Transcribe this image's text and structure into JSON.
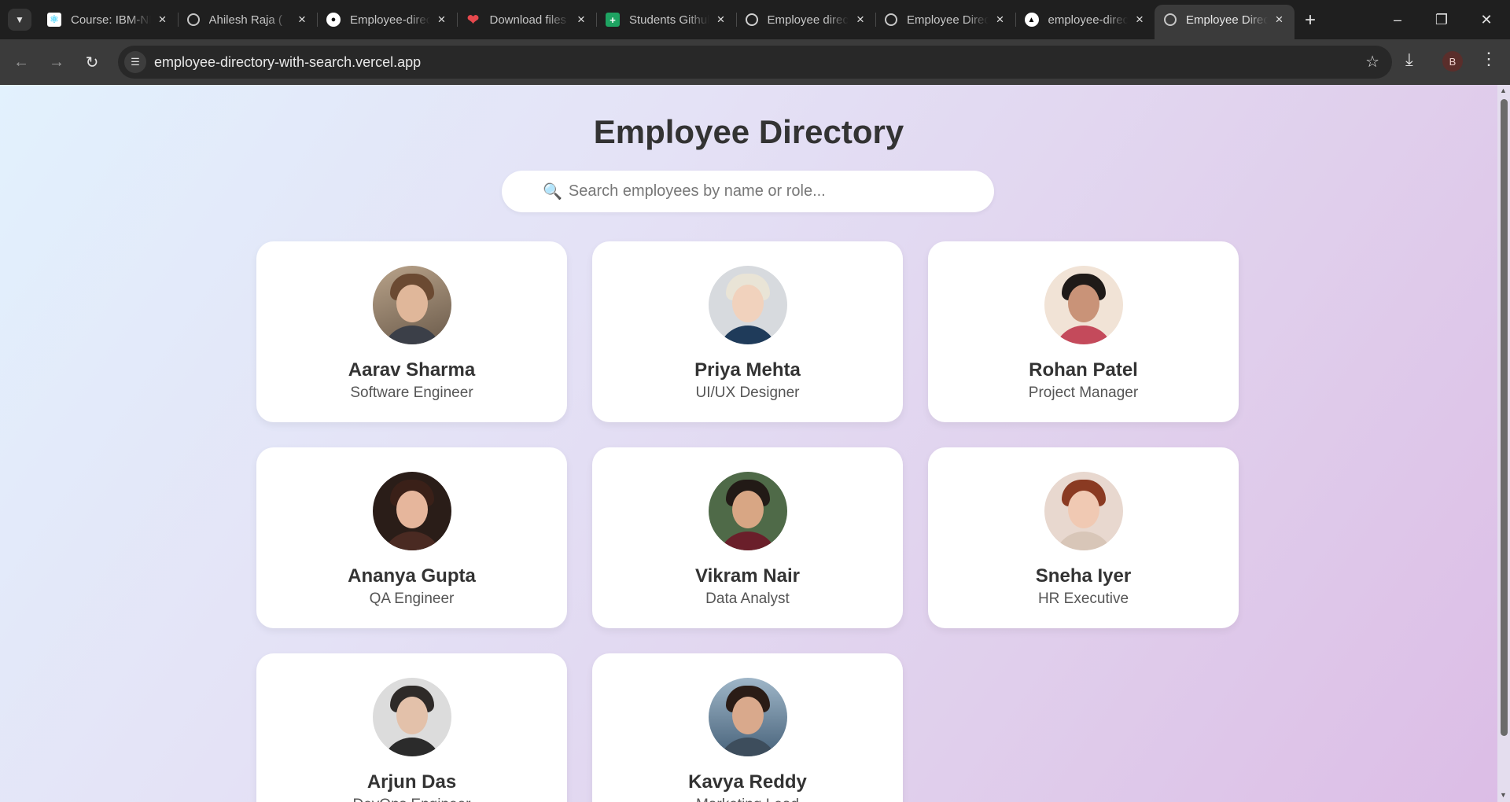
{
  "browser": {
    "tabs": [
      {
        "title": "Course: IBM-NM",
        "favicon": "react-icon"
      },
      {
        "title": "Ahilesh Raja (",
        "favicon": "globe-icon"
      },
      {
        "title": "Employee-directory",
        "favicon": "github-icon"
      },
      {
        "title": "Download files",
        "favicon": "heart-icon"
      },
      {
        "title": "Students Github",
        "favicon": "sheets-icon"
      },
      {
        "title": "Employee directory",
        "favicon": "openai-icon"
      },
      {
        "title": "Employee Directory",
        "favicon": "globe-icon"
      },
      {
        "title": "employee-directory",
        "favicon": "vercel-icon"
      },
      {
        "title": "Employee Directory",
        "favicon": "globe-icon",
        "active": true
      }
    ],
    "url": "employee-directory-with-search.vercel.app",
    "profile_initial": "B"
  },
  "page": {
    "title": "Employee Directory",
    "search": {
      "placeholder": "Search employees by name or role...",
      "value": ""
    },
    "employees": [
      {
        "name": "Aarav Sharma",
        "role": "Software Engineer"
      },
      {
        "name": "Priya Mehta",
        "role": "UI/UX Designer"
      },
      {
        "name": "Rohan Patel",
        "role": "Project Manager"
      },
      {
        "name": "Ananya Gupta",
        "role": "QA Engineer"
      },
      {
        "name": "Vikram Nair",
        "role": "Data Analyst"
      },
      {
        "name": "Sneha Iyer",
        "role": "HR Executive"
      },
      {
        "name": "Arjun Das",
        "role": "DevOps Engineer"
      },
      {
        "name": "Kavya Reddy",
        "role": "Marketing Lead"
      }
    ]
  },
  "colors": {
    "heading": "#333333",
    "card_background": "#ffffff",
    "page_gradient_start": "#e2f1fd",
    "page_gradient_end": "#dcbde6"
  }
}
